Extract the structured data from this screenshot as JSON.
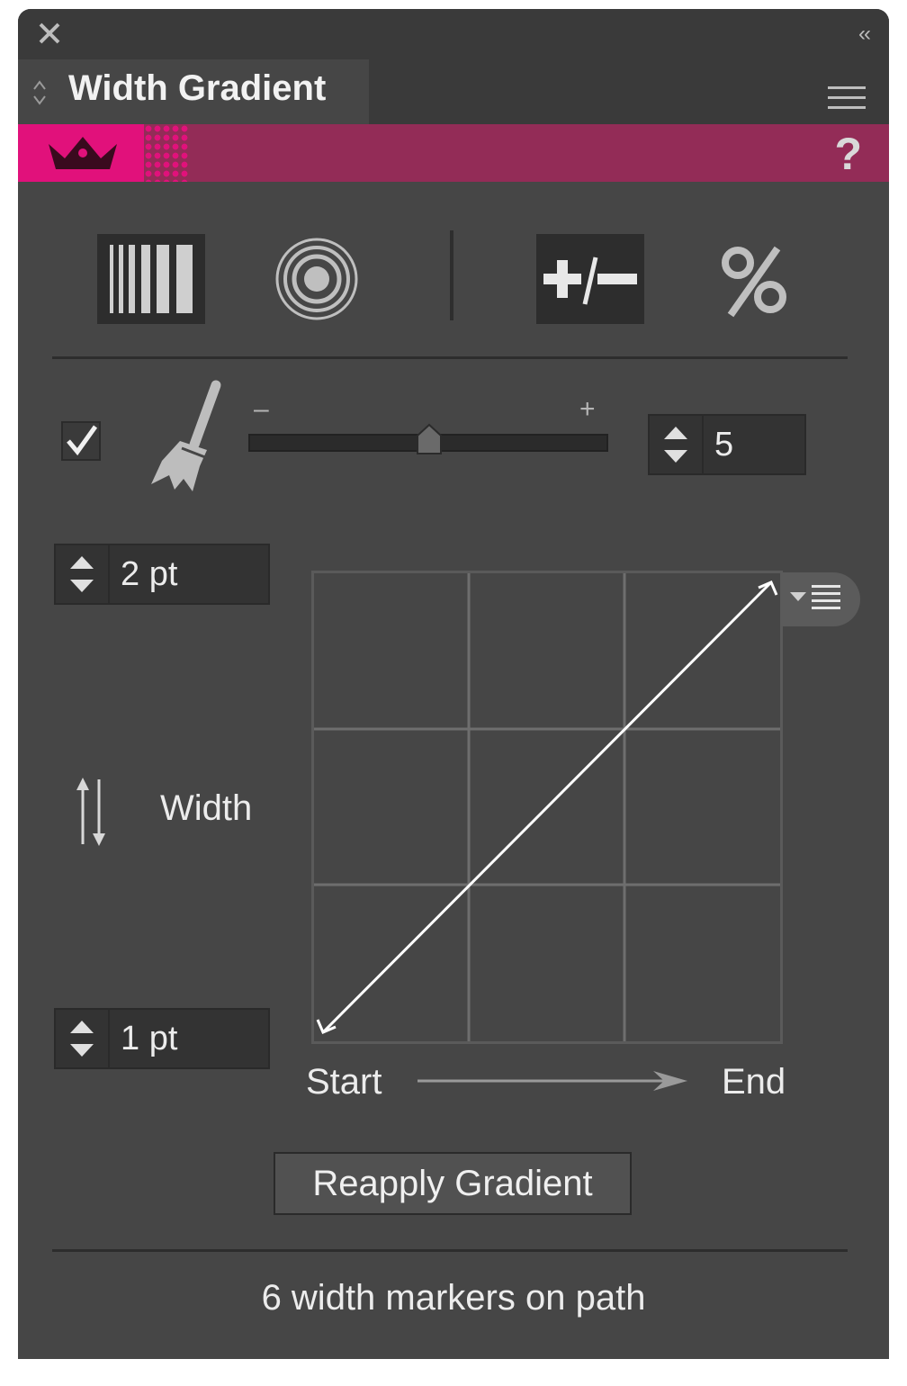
{
  "panel": {
    "title": "Width Gradient",
    "help_label": "?",
    "collapse_label": "‹‹"
  },
  "toolbar": {
    "icons": [
      "linear-gradient-icon",
      "radial-gradient-icon",
      "plus-minus-icon",
      "percent-icon"
    ]
  },
  "slider": {
    "minus_label": "–",
    "plus_label": "+",
    "value": 5,
    "position_fraction": 0.5,
    "enabled": true
  },
  "width_controls": {
    "max_value": "2 pt",
    "min_value": "1 pt",
    "axis_label": "Width"
  },
  "graph": {
    "start_label": "Start",
    "end_label": "End",
    "grid": "3x3",
    "curve": [
      [
        0,
        0
      ],
      [
        1,
        1
      ]
    ]
  },
  "reapply_label": "Reapply Gradient",
  "status_text": "6 width markers on path",
  "colors": {
    "panel_bg": "#464646",
    "brand_magenta": "#e1117b",
    "brand_bar": "#932c57"
  }
}
